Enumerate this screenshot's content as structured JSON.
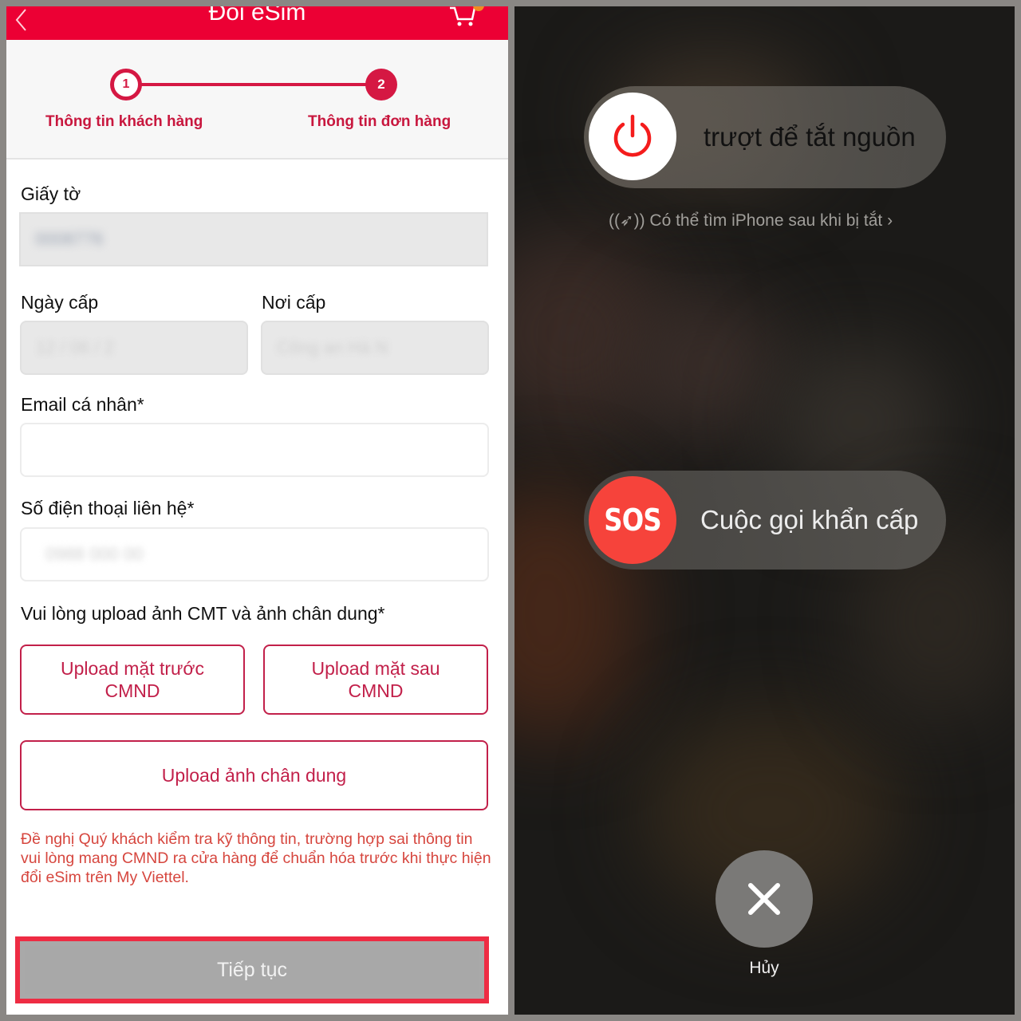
{
  "left_screen": {
    "header": {
      "title": "Đổi eSim",
      "back_icon": "chevron-left-icon",
      "cart_icon": "cart-icon",
      "brand_color": "#ec0034"
    },
    "stepper": {
      "steps": [
        {
          "number": "1",
          "label": "Thông tin khách hàng",
          "state": "current"
        },
        {
          "number": "2",
          "label": "Thông tin đơn hàng",
          "state": "next"
        }
      ],
      "accent_color": "#d51843"
    },
    "form": {
      "document": {
        "label": "Giấy tờ",
        "value": "(blurred)"
      },
      "issue_date": {
        "label": "Ngày cấp",
        "value": "(blurred)"
      },
      "issue_place": {
        "label": "Nơi cấp",
        "value": "(blurred)"
      },
      "email": {
        "label": "Email cá nhân*",
        "value": ""
      },
      "phone": {
        "label": "Số điện thoại liên hệ*",
        "value": "(blurred)"
      },
      "upload_prompt": "Vui lòng upload ảnh CMT và ảnh chân dung*",
      "upload_front": {
        "line1": "Upload mặt trước",
        "line2": "CMND"
      },
      "upload_back": {
        "line1": "Upload mặt sau",
        "line2": "CMND"
      },
      "upload_portrait": "Upload ảnh chân dung"
    },
    "notice": "Đề nghị Quý khách kiểm tra kỹ thông tin, trường hợp sai thông tin vui lòng mang CMND ra cửa hàng để chuẩn hóa trước khi thực hiện đổi eSim trên My Viettel.",
    "continue_button": "Tiếp tục",
    "highlight_color": "#ee2c43"
  },
  "right_screen": {
    "power_slider": {
      "label": "trượt để tắt nguồn",
      "icon": "power-icon"
    },
    "find_my": {
      "text": "Có thể tìm iPhone sau khi bị tắt",
      "icon": "find-my-icon",
      "chevron": "›"
    },
    "sos_slider": {
      "knob_text": "SOS",
      "label": "Cuộc gọi khẩn cấp",
      "color": "#f6433b"
    },
    "cancel": {
      "label": "Hủy",
      "icon": "close-icon"
    }
  }
}
